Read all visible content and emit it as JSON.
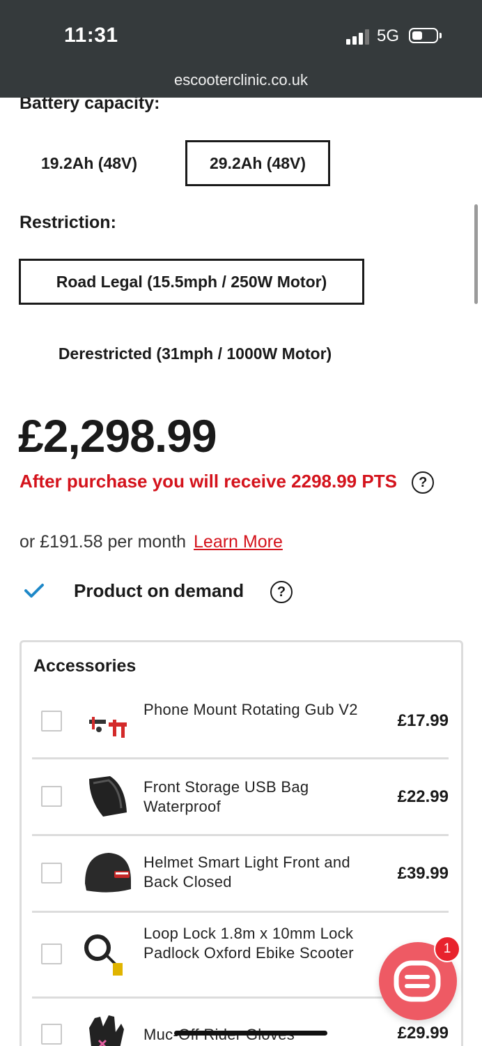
{
  "status_bar": {
    "time": "11:31",
    "network": "5G",
    "url": "escooterclinic.co.uk"
  },
  "battery_capacity": {
    "label": "Battery capacity:",
    "options": [
      "19.2Ah (48V)",
      "29.2Ah (48V)"
    ],
    "selected": "29.2Ah (48V)"
  },
  "restriction": {
    "label": "Restriction:",
    "options": [
      "Road Legal (15.5mph / 250W Motor)",
      "Derestricted (31mph / 1000W Motor)"
    ],
    "selected": "Road Legal (15.5mph / 250W Motor)"
  },
  "pricing": {
    "price": "£2,298.99",
    "points_text": "After purchase you will receive 2298.99 PTS",
    "help_symbol": "?",
    "finance_text": "or £191.58 per month",
    "finance_link": "Learn More"
  },
  "availability": {
    "text": "Product on demand",
    "help_symbol": "?"
  },
  "accessories": {
    "title": "Accessories",
    "items": [
      {
        "name": "Phone Mount Rotating Gub V2",
        "price": "£17.99",
        "icon": "phone-mount-icon"
      },
      {
        "name": "Front Storage USB Bag Waterproof",
        "price": "£22.99",
        "icon": "storage-bag-icon"
      },
      {
        "name": "Helmet Smart Light Front and Back Closed",
        "price": "£39.99",
        "icon": "helmet-icon"
      },
      {
        "name": "Loop Lock 1.8m x 10mm Lock Padlock Oxford Ebike Scooter",
        "price": "",
        "icon": "lock-icon"
      },
      {
        "name": "Muc-Off Rider Gloves",
        "price": "£29.99",
        "icon": "gloves-icon"
      }
    ]
  },
  "chat": {
    "badge_count": "1"
  },
  "colors": {
    "status_bar_bg": "#353a3c",
    "accent_red": "#d4131c",
    "check_blue": "#1e88c8",
    "chat_button": "#ee5a64"
  }
}
